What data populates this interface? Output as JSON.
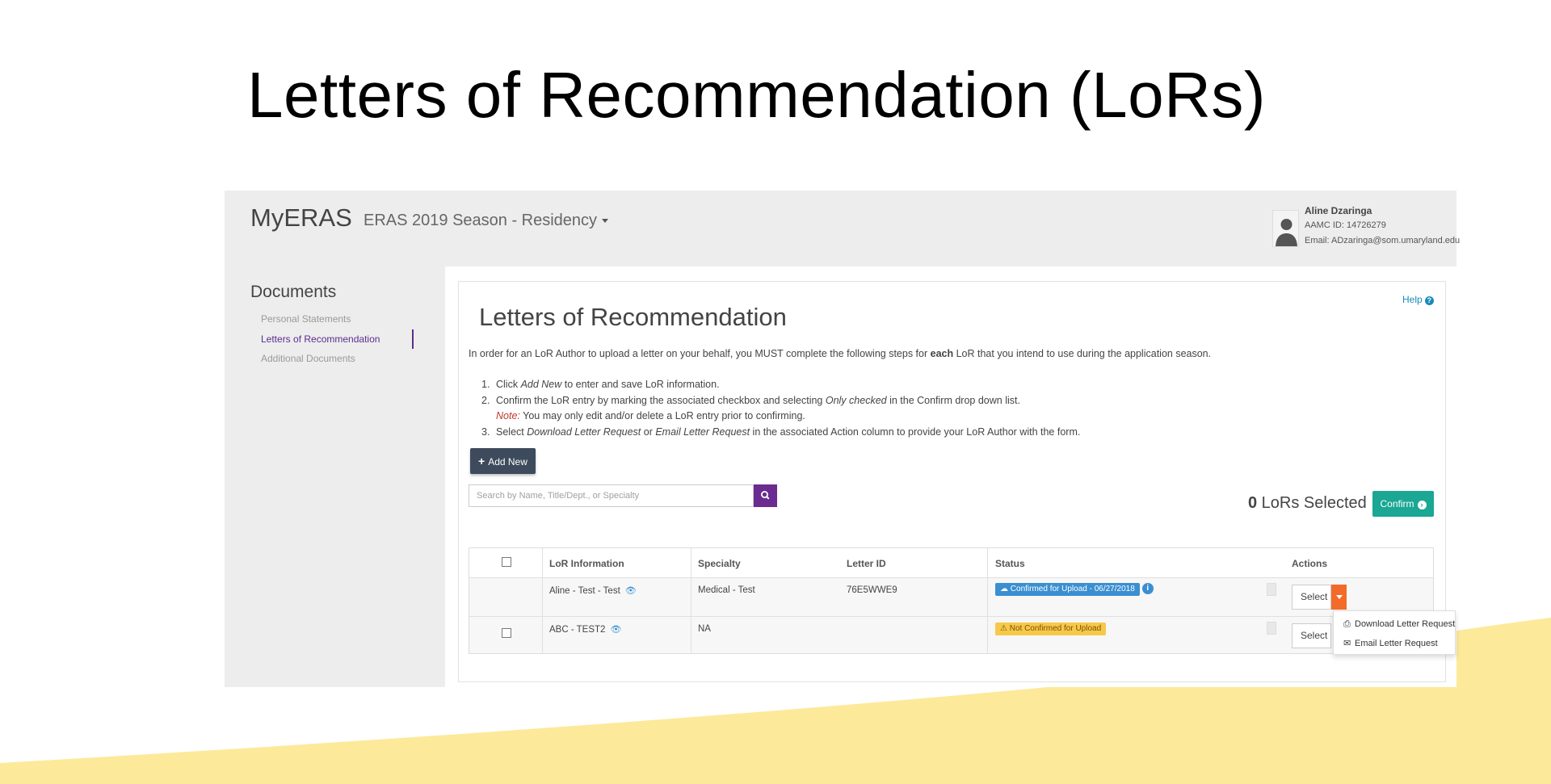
{
  "slide": {
    "title": "Letters of Recommendation (LoRs)",
    "wave_color": "#fde99a"
  },
  "app": {
    "brand": "MyERAS",
    "season": "ERAS 2019 Season - Residency",
    "user": {
      "name": "Aline Dzaringa",
      "aamc_id": "AAMC ID: 14726279",
      "email": "Email: ADzaringa@som.umaryland.edu"
    },
    "sidebar": {
      "heading": "Documents",
      "items": [
        {
          "label": "Personal Statements",
          "active": false
        },
        {
          "label": "Letters of Recommendation",
          "active": true
        },
        {
          "label": "Additional Documents",
          "active": false
        }
      ]
    },
    "main": {
      "help": "Help",
      "title": "Letters of Recommendation",
      "intro_prefix": "In order for an LoR Author to upload a letter on your behalf, you MUST complete the following steps for ",
      "intro_bold": "each",
      "intro_suffix": " LoR that you intend to use during the application season.",
      "steps": {
        "s1_num": "1.",
        "s1_pre": "Click ",
        "s1_em": "Add New",
        "s1_post": " to enter and save LoR information.",
        "s2_num": "2.",
        "s2_pre": "Confirm the LoR entry by marking the associated checkbox and selecting ",
        "s2_em": "Only checked",
        "s2_post": " in the Confirm drop down list.",
        "note_label": "Note:",
        "note_text": " You may only edit and/or delete a LoR entry prior to confirming.",
        "s3_num": "3.",
        "s3_pre": "Select ",
        "s3_em1": "Download Letter Request",
        "s3_mid": " or ",
        "s3_em2": "Email Letter Request",
        "s3_post": " in the associated Action column to provide your LoR Author with the form."
      },
      "add_new": "Add New",
      "search_placeholder": "Search by Name, Title/Dept., or Specialty",
      "selected_count": "0",
      "selected_label": " LoRs Selected",
      "confirm": "Confirm",
      "table": {
        "headers": [
          "LoR Information",
          "Specialty",
          "Letter ID",
          "Status",
          "Actions"
        ],
        "rows": [
          {
            "lor": "Aline - Test - Test",
            "specialty": "Medical - Test",
            "letter_id": "76E5WWE9",
            "status": "Confirmed for Upload - 06/27/2018",
            "action": "Select"
          },
          {
            "lor": "ABC - TEST2",
            "specialty": "NA",
            "letter_id": "",
            "status": "Not Confirmed for Upload",
            "action": "Select"
          }
        ]
      },
      "dropdown": [
        "Download Letter Request",
        "Email Letter Request"
      ]
    }
  }
}
